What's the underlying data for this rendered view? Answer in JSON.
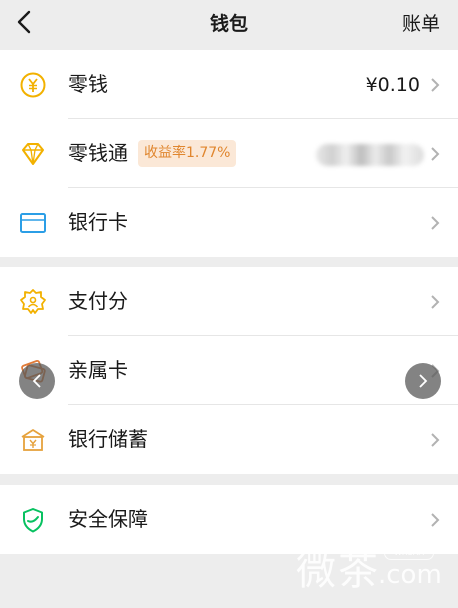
{
  "header": {
    "title": "钱包",
    "right_action": "账单",
    "back_icon": "chevron-left-icon"
  },
  "section1": {
    "items": [
      {
        "label": "零钱",
        "value": "¥0.10",
        "icon": "yuan-coin-icon",
        "icon_color": "#f2b100"
      },
      {
        "label": "零钱通",
        "badge": "收益率1.77%",
        "value_hidden": true,
        "icon": "diamond-icon",
        "icon_color": "#f2b100"
      },
      {
        "label": "银行卡",
        "icon": "bank-card-icon",
        "icon_color": "#2b9ee6"
      }
    ]
  },
  "section2": {
    "items": [
      {
        "label": "支付分",
        "icon": "payment-score-icon",
        "icon_color": "#f2b100"
      },
      {
        "label": "亲属卡",
        "icon": "family-card-icon",
        "icon_color": "#e07b39"
      },
      {
        "label": "银行储蓄",
        "icon": "bank-savings-icon",
        "icon_color": "#e6a23c"
      }
    ]
  },
  "section3": {
    "items": [
      {
        "label": "安全保障",
        "icon": "shield-check-icon",
        "icon_color": "#07c160"
      }
    ]
  },
  "watermark": {
    "text": "微茶",
    "badge": "WXCHA",
    "domain": ".com"
  },
  "colors": {
    "background": "#ededed",
    "badge_bg": "#fbe8d7",
    "badge_text": "#e0862e"
  }
}
